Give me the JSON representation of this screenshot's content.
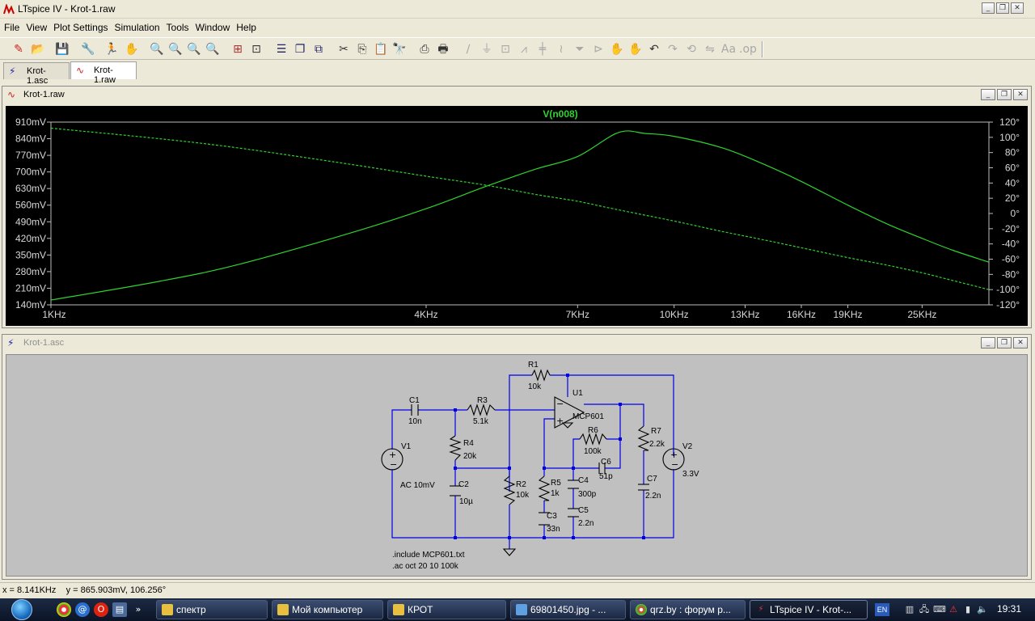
{
  "app": {
    "title": "LTspice IV - Krot-1.raw"
  },
  "menu": [
    "File",
    "View",
    "Plot Settings",
    "Simulation",
    "Tools",
    "Window",
    "Help"
  ],
  "tabs": [
    {
      "label": "Krot-1.asc",
      "icon": "schematic-icon",
      "active": false
    },
    {
      "label": "Krot-1.raw",
      "icon": "waveform-icon",
      "active": true
    }
  ],
  "plot_window": {
    "title": "Krot-1.raw"
  },
  "schematic_window": {
    "title": "Krot-1.asc"
  },
  "chart_data": {
    "type": "line",
    "title": "V(n008)",
    "x_scale": "log",
    "x_ticks": [
      "1KHz",
      "4KHz",
      "7KHz",
      "10KHz",
      "13KHz",
      "16KHz",
      "19KHz",
      "25KHz"
    ],
    "x_tick_values": [
      1000,
      4000,
      7000,
      10000,
      13000,
      16000,
      19000,
      25000
    ],
    "xlim": [
      1000,
      32000
    ],
    "y_left_ticks": [
      "910mV",
      "840mV",
      "770mV",
      "700mV",
      "630mV",
      "560mV",
      "490mV",
      "420mV",
      "350mV",
      "280mV",
      "210mV",
      "140mV"
    ],
    "ylim_left_mV": [
      140,
      910
    ],
    "y_right_ticks": [
      "120°",
      "100°",
      "80°",
      "60°",
      "40°",
      "20°",
      "0°",
      "-20°",
      "-40°",
      "-60°",
      "-80°",
      "-100°",
      "-120°"
    ],
    "ylim_right_deg": [
      -120,
      120
    ],
    "colors": {
      "trace": "#2fd32f",
      "grid_text": "#d8d8d8",
      "title": "#2fd32f"
    },
    "series": [
      {
        "name": "V(n008)",
        "axis": "left",
        "style": "solid",
        "x": [
          1000,
          1500,
          2000,
          3000,
          4000,
          5000,
          6000,
          7000,
          8141,
          9000,
          10000,
          12000,
          14000,
          16000,
          19000,
          22000,
          25000,
          28000,
          32000
        ],
        "values": [
          160,
          240,
          310,
          440,
          545,
          640,
          712,
          765,
          866,
          862,
          850,
          800,
          730,
          660,
          560,
          480,
          420,
          370,
          320
        ]
      },
      {
        "name": "phase",
        "axis": "right",
        "style": "dashed",
        "x": [
          1000,
          1500,
          2000,
          3000,
          4000,
          5000,
          6000,
          7000,
          8000,
          10000,
          12000,
          14000,
          16000,
          19000,
          22000,
          25000,
          28000,
          32000
        ],
        "values": [
          112,
          98,
          86,
          65,
          49,
          37,
          25,
          16,
          6,
          -10,
          -24,
          -35,
          -45,
          -58,
          -68,
          -78,
          -88,
          -100
        ]
      }
    ]
  },
  "schematic": {
    "components": [
      {
        "ref": "R1",
        "value": "10k"
      },
      {
        "ref": "C1",
        "value": "10n"
      },
      {
        "ref": "R3",
        "value": "5.1k"
      },
      {
        "ref": "U1",
        "value": "MCP601"
      },
      {
        "ref": "V1",
        "value": "AC 10mV"
      },
      {
        "ref": "R4",
        "value": "20k"
      },
      {
        "ref": "C2",
        "value": "10µ"
      },
      {
        "ref": "R2",
        "value": "10k"
      },
      {
        "ref": "R6",
        "value": "100k"
      },
      {
        "ref": "C6",
        "value": "51p"
      },
      {
        "ref": "R5",
        "value": "1k"
      },
      {
        "ref": "C4",
        "value": "300p"
      },
      {
        "ref": "C3",
        "value": "33n"
      },
      {
        "ref": "C5",
        "value": "2.2n"
      },
      {
        "ref": "R7",
        "value": "2.2k"
      },
      {
        "ref": "C7",
        "value": "2.2n"
      },
      {
        "ref": "V2",
        "value": "3.3V"
      }
    ],
    "directives": [
      ".include MCP601.txt",
      ".ac oct 20 10 100k"
    ]
  },
  "status": {
    "text": "x = 8.141KHz    y = 865.903mV, 106.256°"
  },
  "taskbar": {
    "items": [
      {
        "label": "спектр",
        "icon": "folder-icon"
      },
      {
        "label": "Мой компьютер",
        "icon": "computer-icon"
      },
      {
        "label": "КРОТ",
        "icon": "folder-icon"
      },
      {
        "label": "69801450.jpg - ...",
        "icon": "image-icon"
      },
      {
        "label": "qrz.by : форум р...",
        "icon": "chrome-icon"
      },
      {
        "label": "LTspice IV - Krot-...",
        "icon": "ltspice-icon",
        "active": true
      }
    ],
    "lang": "EN",
    "clock": "19:31"
  }
}
